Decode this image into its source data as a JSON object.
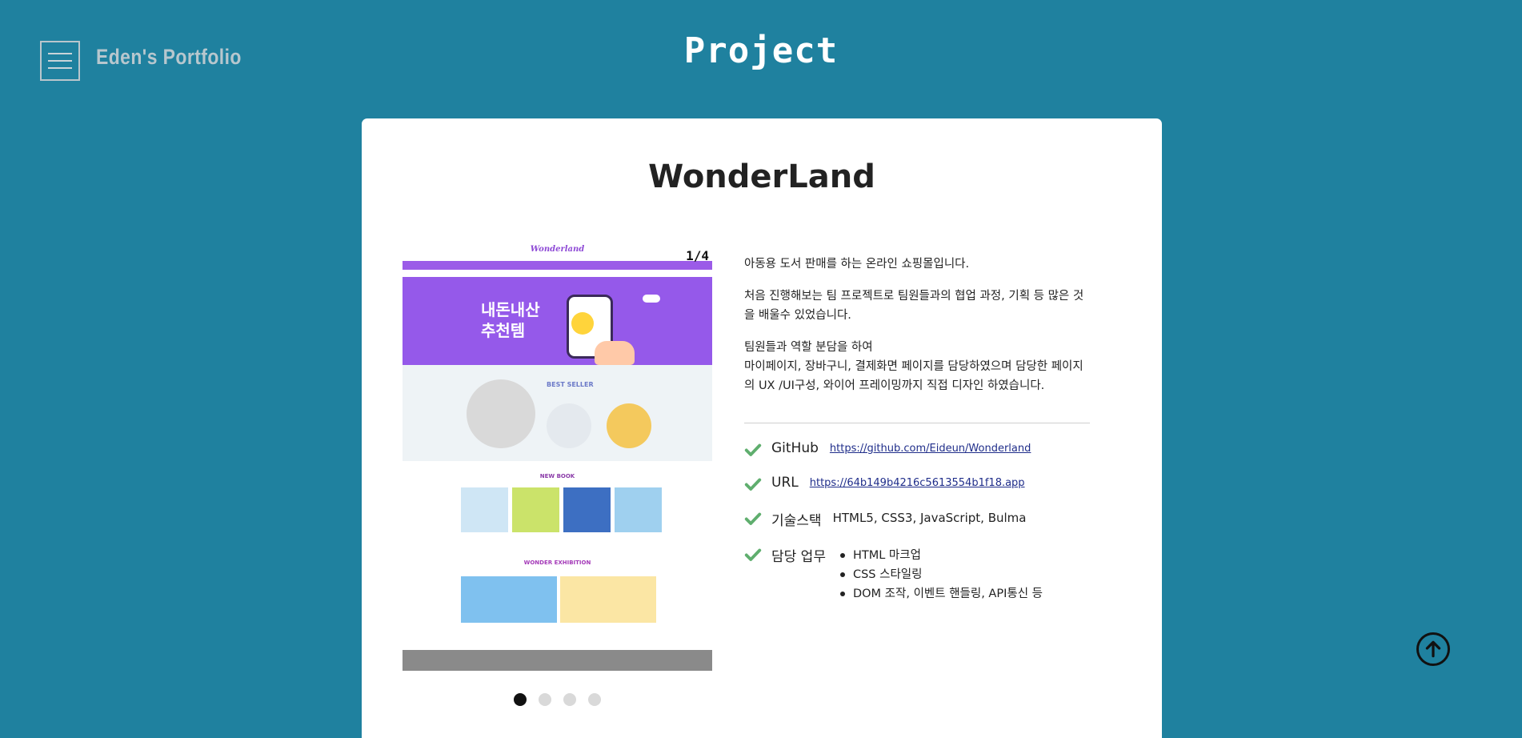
{
  "header": {
    "brand": "Eden's Portfolio",
    "title": "Project"
  },
  "project": {
    "name": "WonderLand",
    "slide_counter": "1/4",
    "slides_total": 4,
    "active_slide": 1,
    "screenshot": {
      "logo": "Wonderland",
      "banner_line1": "내돈내산",
      "banner_line2": "추천템",
      "best_seller": "BEST SELLER",
      "new_book": "NEW BOOK",
      "wonder_exhibition": "WONDER EXHIBITION"
    },
    "description": {
      "p1": "아동용 도서 판매를 하는 온라인 쇼핑몰입니다.",
      "p2": "처음 진행해보는 팀 프로젝트로 팀원들과의 협업 과정, 기획 등 많은 것을 배울수 있었습니다.",
      "p3_line1": "팀원들과 역할 분담을 하여",
      "p3_line2": "마이페이지, 장바구니, 결제화면 페이지를 담당하였으며 담당한 페이지의 UX /UI구성, 와이어 프레이밍까지 직접 디자인 하였습니다."
    },
    "info": {
      "github_label": "GitHub",
      "github_url": "https://github.com/Eideun/Wonderland",
      "url_label": "URL",
      "url_value": "https://64b149b4216c5613554b1f18.app",
      "stack_label": "기술스택",
      "stack_value": "HTML5, CSS3, JavaScript, Bulma",
      "duty_label": "담당 업무",
      "duties": [
        "HTML 마크업",
        "CSS 스타일링",
        "DOM 조작, 이벤트 핸들링, API통신 등"
      ]
    }
  },
  "colors": {
    "background": "#1f819f",
    "check": "#5fae6e",
    "dot_active": "#111111",
    "dot_inactive": "#d9d9d9"
  },
  "icons": {
    "menu": "hamburger-icon",
    "check": "check-icon",
    "scroll_top": "arrow-up-circle-icon"
  }
}
